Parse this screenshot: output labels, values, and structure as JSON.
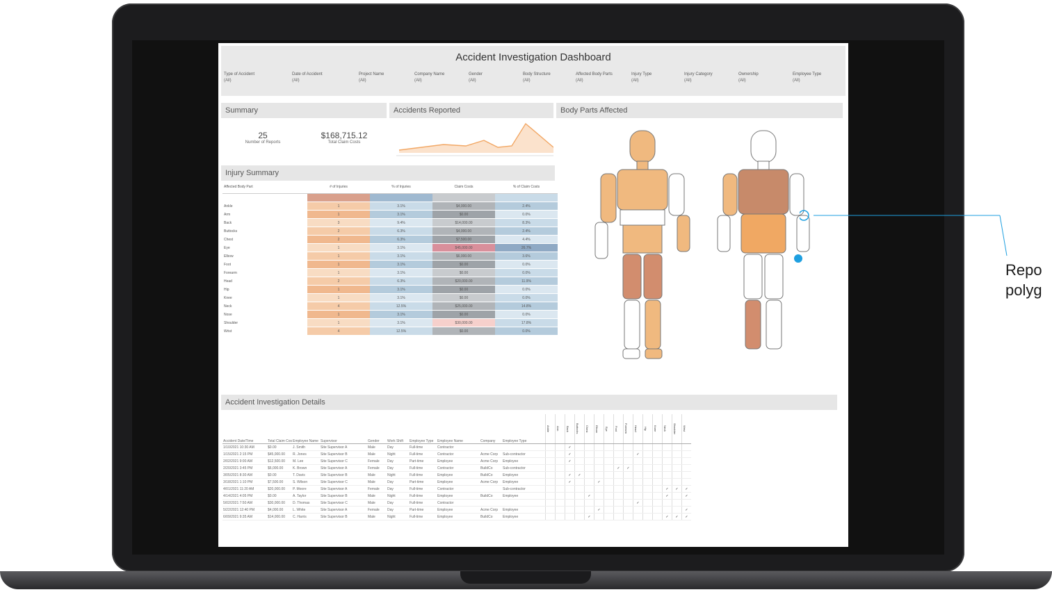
{
  "callout": {
    "text_line1": "Repo",
    "text_line2": "polyg"
  },
  "dashboard": {
    "title": "Accident Investigation Dashboard",
    "filters": [
      {
        "label": "Type of Accident",
        "value": "(All)"
      },
      {
        "label": "Date of Accident",
        "value": "(All)"
      },
      {
        "label": "Project Name",
        "value": "(All)"
      },
      {
        "label": "Company Name",
        "value": "(All)"
      },
      {
        "label": "Gender",
        "value": "(All)"
      },
      {
        "label": "Body Structure",
        "value": "(All)"
      },
      {
        "label": "Affected Body Parts",
        "value": "(All)"
      },
      {
        "label": "Injury Type",
        "value": "(All)"
      },
      {
        "label": "Injury Category",
        "value": "(All)"
      },
      {
        "label": "Ownership",
        "value": "(All)"
      },
      {
        "label": "Employee Type",
        "value": "(All)"
      }
    ],
    "summary": {
      "title": "Summary",
      "reports_num": "25",
      "reports_label": "Number of Reports",
      "cost_num": "$168,715.12",
      "cost_label": "Total Claim Costs"
    },
    "accidents": {
      "title": "Accidents Reported"
    },
    "body": {
      "title": "Body Parts Affected"
    },
    "injury_summary": {
      "title": "Injury Summary",
      "headers": [
        "Affected Body Part",
        "# of Injuries",
        "% of Injuries",
        "Claim Costs",
        "% of Claim Costs"
      ],
      "rows": [
        {
          "part": "",
          "n": "",
          "pct": "",
          "cost": "",
          "pc": ""
        },
        {
          "part": "Ankle",
          "n": "1",
          "pct": "3.1%",
          "cost": "$4,000.00",
          "pc": "2.4%"
        },
        {
          "part": "Arm",
          "n": "1",
          "pct": "3.1%",
          "cost": "$0.00",
          "pc": "0.0%"
        },
        {
          "part": "Back",
          "n": "3",
          "pct": "9.4%",
          "cost": "$14,000.00",
          "pc": "8.3%"
        },
        {
          "part": "Buttocks",
          "n": "2",
          "pct": "6.3%",
          "cost": "$4,000.00",
          "pc": "2.4%"
        },
        {
          "part": "Chest",
          "n": "2",
          "pct": "6.3%",
          "cost": "$7,500.00",
          "pc": "4.4%"
        },
        {
          "part": "Eye",
          "n": "1",
          "pct": "3.1%",
          "cost": "$45,000.00",
          "pc": "26.7%"
        },
        {
          "part": "Elbow",
          "n": "1",
          "pct": "3.1%",
          "cost": "$6,000.00",
          "pc": "3.6%"
        },
        {
          "part": "Foot",
          "n": "1",
          "pct": "3.1%",
          "cost": "$0.00",
          "pc": "0.0%"
        },
        {
          "part": "Forearm",
          "n": "1",
          "pct": "3.1%",
          "cost": "$0.00",
          "pc": "0.0%"
        },
        {
          "part": "Head",
          "n": "2",
          "pct": "6.3%",
          "cost": "$20,000.00",
          "pc": "11.9%"
        },
        {
          "part": "Hip",
          "n": "1",
          "pct": "3.1%",
          "cost": "$0.00",
          "pc": "0.0%"
        },
        {
          "part": "Knee",
          "n": "1",
          "pct": "3.1%",
          "cost": "$0.00",
          "pc": "0.0%"
        },
        {
          "part": "Neck",
          "n": "4",
          "pct": "12.5%",
          "cost": "$25,000.00",
          "pc": "14.8%"
        },
        {
          "part": "Nose",
          "n": "1",
          "pct": "3.1%",
          "cost": "$0.00",
          "pc": "0.0%"
        },
        {
          "part": "Shoulder",
          "n": "1",
          "pct": "3.1%",
          "cost": "$30,000.00",
          "pc": "17.8%"
        },
        {
          "part": "Wrist",
          "n": "4",
          "pct": "12.5%",
          "cost": "$0.00",
          "pc": "0.0%"
        }
      ]
    },
    "details": {
      "title": "Accident Investigation Details",
      "check_group": "Affected Body Parts",
      "headers": [
        "Accident Date/Time",
        "Total Claim Costs",
        "Employee Name",
        "Supervisor",
        "Gender",
        "Work Shift",
        "Employee Type",
        "Employee Name",
        "Company",
        "Employee Type"
      ],
      "check_cols": [
        "Ankle",
        "Arm",
        "Back",
        "Buttocks",
        "Chest",
        "Elbow",
        "Eye",
        "Foot",
        "Forearm",
        "Head",
        "Hip",
        "Knee",
        "Neck",
        "Shoulder",
        "Wrist"
      ],
      "rows": [
        [
          "1/10/2021 10:30 AM",
          "$0.00",
          "J. Smith",
          "Site Supervisor A",
          "Male",
          "Day",
          "Full-time",
          "Contractor",
          "",
          ""
        ],
        [
          "1/15/2021 2:15 PM",
          "$45,000.00",
          "R. Jones",
          "Site Supervisor B",
          "Male",
          "Night",
          "Full-time",
          "Contractor",
          "Acme Corp",
          "Sub-contractor"
        ],
        [
          "2/02/2021 9:00 AM",
          "$12,500.00",
          "M. Lee",
          "Site Supervisor C",
          "Female",
          "Day",
          "Part-time",
          "Employee",
          "Acme Corp",
          "Employee"
        ],
        [
          "2/20/2021 3:45 PM",
          "$6,000.00",
          "K. Brown",
          "Site Supervisor A",
          "Female",
          "Day",
          "Full-time",
          "Contractor",
          "BuildCo",
          "Sub-contractor"
        ],
        [
          "3/05/2021 8:30 AM",
          "$0.00",
          "T. Davis",
          "Site Supervisor B",
          "Male",
          "Night",
          "Full-time",
          "Employee",
          "BuildCo",
          "Employee"
        ],
        [
          "3/18/2021 1:10 PM",
          "$7,500.00",
          "S. Wilson",
          "Site Supervisor C",
          "Male",
          "Day",
          "Part-time",
          "Employee",
          "Acme Corp",
          "Employee"
        ],
        [
          "4/01/2021 11:20 AM",
          "$20,000.00",
          "P. Moore",
          "Site Supervisor A",
          "Female",
          "Day",
          "Full-time",
          "Contractor",
          "",
          "Sub-contractor"
        ],
        [
          "4/14/2021 4:05 PM",
          "$0.00",
          "A. Taylor",
          "Site Supervisor B",
          "Male",
          "Night",
          "Full-time",
          "Employee",
          "BuildCo",
          "Employee"
        ],
        [
          "5/02/2021 7:50 AM",
          "$30,000.00",
          "D. Thomas",
          "Site Supervisor C",
          "Male",
          "Day",
          "Full-time",
          "Contractor",
          "",
          ""
        ],
        [
          "5/22/2021 12:40 PM",
          "$4,000.00",
          "L. White",
          "Site Supervisor A",
          "Female",
          "Day",
          "Part-time",
          "Employee",
          "Acme Corp",
          "Employee"
        ],
        [
          "6/09/2021 9:35 AM",
          "$14,000.00",
          "C. Harris",
          "Site Supervisor B",
          "Male",
          "Night",
          "Full-time",
          "Employee",
          "BuildCo",
          "Employee"
        ]
      ],
      "checks": [
        [
          2
        ],
        [
          2,
          9
        ],
        [
          2
        ],
        [
          7,
          8
        ],
        [
          2,
          3
        ],
        [
          2,
          5
        ],
        [
          12,
          13,
          14
        ],
        [
          4,
          12,
          14
        ],
        [
          9
        ],
        [
          5,
          14
        ],
        [
          4,
          12,
          13,
          14
        ]
      ]
    }
  },
  "colors": {
    "heat_orange": "#f0b88e",
    "heat_blue": "#c9dbe8",
    "heat_grey": "#9ea3a8",
    "line": "#f2a764",
    "fig_front": "#f0b97f",
    "fig_dark": "#c78a6a"
  }
}
